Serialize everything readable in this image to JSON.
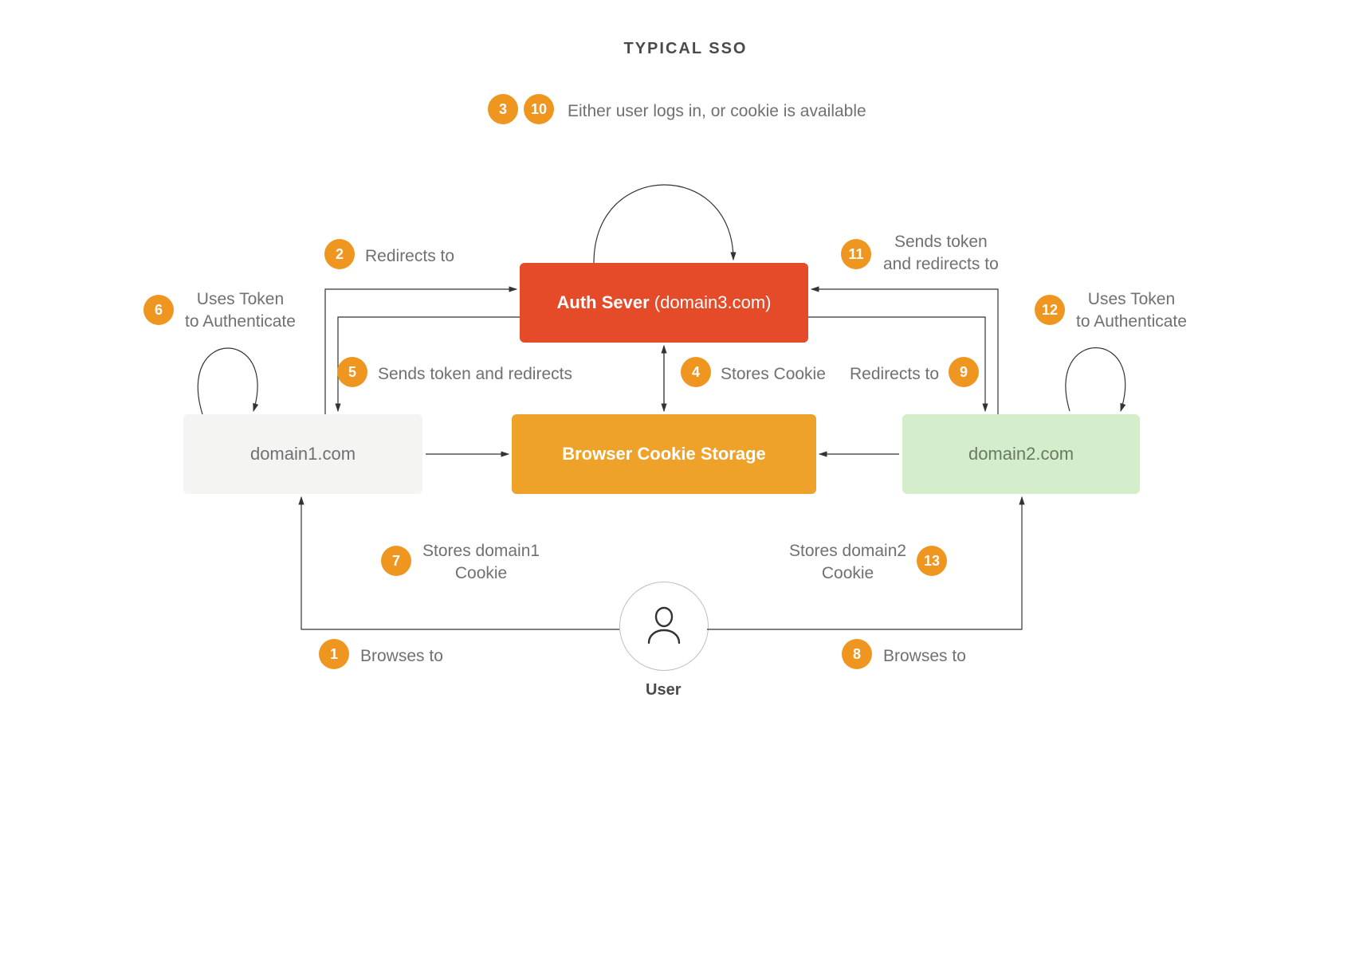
{
  "title": "TYPICAL SSO",
  "boxes": {
    "auth": {
      "bold": "Auth Sever",
      "rest": " (domain3.com)"
    },
    "cookie": "Browser Cookie Storage",
    "domain1": "domain1.com",
    "domain2": "domain2.com"
  },
  "user_label": "User",
  "steps": {
    "1": "Browses to",
    "2": "Redirects to",
    "3_10": "Either user logs in, or cookie is available",
    "4": "Stores Cookie",
    "5": "Sends token and redirects",
    "6": "Uses Token\nto Authenticate",
    "7": "Stores domain1\nCookie",
    "8": "Browses to",
    "9": "Redirects to",
    "11": "Sends token\nand redirects to",
    "12": "Uses Token\nto Authenticate",
    "13": "Stores domain2\nCookie"
  },
  "badges": {
    "1": "1",
    "2": "2",
    "3": "3",
    "4": "4",
    "5": "5",
    "6": "6",
    "7": "7",
    "8": "8",
    "9": "9",
    "10": "10",
    "11": "11",
    "12": "12",
    "13": "13"
  }
}
